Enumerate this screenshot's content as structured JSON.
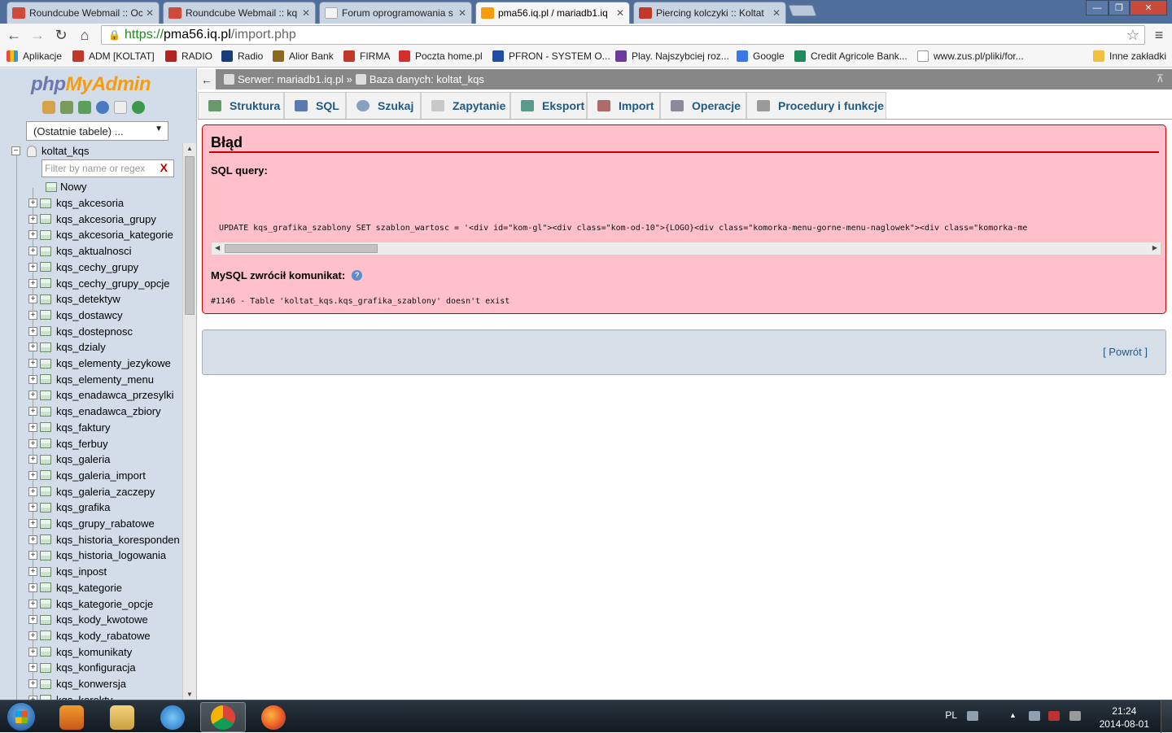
{
  "browser": {
    "tabs": [
      {
        "title": "Roundcube Webmail :: Oc",
        "active": false
      },
      {
        "title": "Roundcube Webmail :: kq",
        "active": false
      },
      {
        "title": "Forum oprogramowania s",
        "active": false
      },
      {
        "title": "pma56.iq.pl / mariadb1.iq",
        "active": true
      },
      {
        "title": "Piercing kolczyki :: Koltat",
        "active": false
      }
    ],
    "url": {
      "protocol": "https://",
      "host": "pma56.iq.pl",
      "path": "/import.php"
    },
    "bookmarks": [
      {
        "label": "Aplikacje",
        "color": "#d04a3a"
      },
      {
        "label": "ADM [KOLTAT]",
        "color": "#c0392b"
      },
      {
        "label": "RADIO",
        "color": "#b22222"
      },
      {
        "label": "Radio",
        "color": "#1a3d7a"
      },
      {
        "label": "Alior Bank",
        "color": "#8b6a1e"
      },
      {
        "label": "FIRMA",
        "color": "#c0392b"
      },
      {
        "label": "Poczta home.pl",
        "color": "#d32f2f"
      },
      {
        "label": "PFRON - SYSTEM O...",
        "color": "#1f4fa3"
      },
      {
        "label": "Play. Najszybciej roz...",
        "color": "#6a3d9a"
      },
      {
        "label": "Google",
        "color": "#3b78e7"
      },
      {
        "label": "Credit Agricole Bank...",
        "color": "#1e8a5a"
      },
      {
        "label": "www.zus.pl/pliki/for...",
        "color": "#dddddd"
      },
      {
        "label": "Inne zakładki",
        "color": "#f0c040"
      }
    ]
  },
  "pma": {
    "logo_php": "php",
    "logo_myadmin": "MyAdmin",
    "recent_tables": "(Ostatnie tabele) ...",
    "database": "koltat_kqs",
    "filter_placeholder": "Filter by name or regex",
    "filter_clear": "X",
    "new_label": "Nowy",
    "tables": [
      "kqs_akcesoria",
      "kqs_akcesoria_grupy",
      "kqs_akcesoria_kategorie",
      "kqs_aktualnosci",
      "kqs_cechy_grupy",
      "kqs_cechy_grupy_opcje",
      "kqs_detektyw",
      "kqs_dostawcy",
      "kqs_dostepnosc",
      "kqs_dzialy",
      "kqs_elementy_jezykowe",
      "kqs_elementy_menu",
      "kqs_enadawca_przesylki",
      "kqs_enadawca_zbiory",
      "kqs_faktury",
      "kqs_ferbuy",
      "kqs_galeria",
      "kqs_galeria_import",
      "kqs_galeria_zaczepy",
      "kqs_grafika",
      "kqs_grupy_rabatowe",
      "kqs_historia_koresponden",
      "kqs_historia_logowania",
      "kqs_inpost",
      "kqs_kategorie",
      "kqs_kategorie_opcje",
      "kqs_kody_kwotowe",
      "kqs_kody_rabatowe",
      "kqs_komunikaty",
      "kqs_konfiguracja",
      "kqs_konwersja",
      "kqs_korekty"
    ],
    "breadcrumb": {
      "server": "Serwer: mariadb1.iq.pl »",
      "database": "Baza danych: koltat_kqs"
    },
    "tabs": [
      "Struktura",
      "SQL",
      "Szukaj",
      "Zapytanie",
      "Eksport",
      "Import",
      "Operacje",
      "Procedury i funkcje"
    ],
    "error": {
      "title": "Błąd",
      "sql_label": "SQL query:",
      "sql": "UPDATE kqs_grafika_szablony SET szablon_wartosc = '<div id=\"kom-gl\"><div class=\"kom-od-10\">{LOGO}<div class=\"komorka-menu-gorne-menu-naglowek\"><div class=\"komorka-me",
      "message_label": "MySQL zwrócił komunikat:",
      "message": "#1146 - Table 'koltat_kqs.kqs_grafika_szablony' doesn't exist"
    },
    "back_link": "[ Powrót ]"
  },
  "taskbar": {
    "lang": "PL",
    "time": "21:24",
    "date": "2014-08-01"
  }
}
